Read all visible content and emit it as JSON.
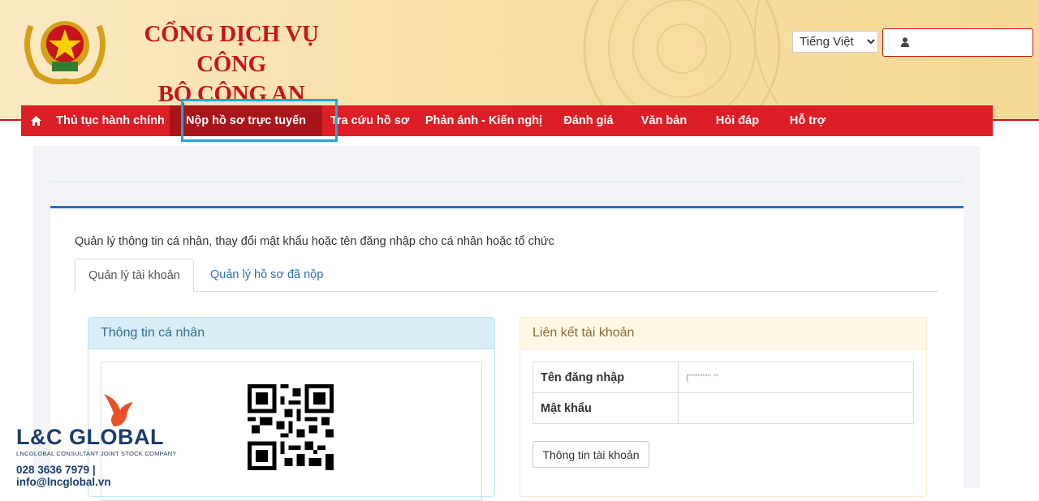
{
  "header": {
    "title_line1": "CỔNG DỊCH VỤ CÔNG",
    "title_line2": "BỘ CÔNG AN",
    "language": "Tiếng Việt",
    "user_placeholder": ""
  },
  "nav": {
    "items": [
      {
        "label": "Thủ tục hành chính"
      },
      {
        "label": "Nộp hồ sơ trực tuyến"
      },
      {
        "label": "Tra cứu hồ sơ"
      },
      {
        "label": "Phản ánh - Kiến nghị"
      },
      {
        "label": "Đánh giá"
      },
      {
        "label": "Văn bản"
      },
      {
        "label": "Hỏi đáp"
      },
      {
        "label": "Hỗ trợ"
      }
    ],
    "active_index": 1
  },
  "main": {
    "description": "Quản lý thông tin cá nhân, thay đổi mật khẩu hoặc tên đăng nhập cho cá nhân hoặc tổ chức",
    "tabs": [
      {
        "label": "Quản lý tài khoản"
      },
      {
        "label": "Quản lý hồ sơ đã nộp"
      }
    ],
    "personal_info": {
      "title": "Thông tin cá nhân"
    },
    "account_link": {
      "title": "Liên kết tài khoản",
      "rows": [
        {
          "key": "Tên đăng nhập",
          "value": "(''''''''''''' '''"
        },
        {
          "key": "Mật khẩu",
          "value": ""
        }
      ],
      "button": "Thông tin tài khoản"
    }
  },
  "watermark": {
    "name": "L&C GLOBAL",
    "subtitle": "LNCGLOBAL CONSULTANT JOINT STOCK COMPANY",
    "contact": "028 3636 7979 | info@lncglobal.vn"
  },
  "colors": {
    "brand_red": "#dc1f26",
    "active_red": "#a8151a",
    "highlight_blue": "#27a3dc",
    "panel_top_blue": "#2b6fb3"
  },
  "icons": [
    "home-icon",
    "user-icon",
    "chevron-down-icon",
    "emblem-logo",
    "qr-code",
    "lc-bird-logo"
  ]
}
